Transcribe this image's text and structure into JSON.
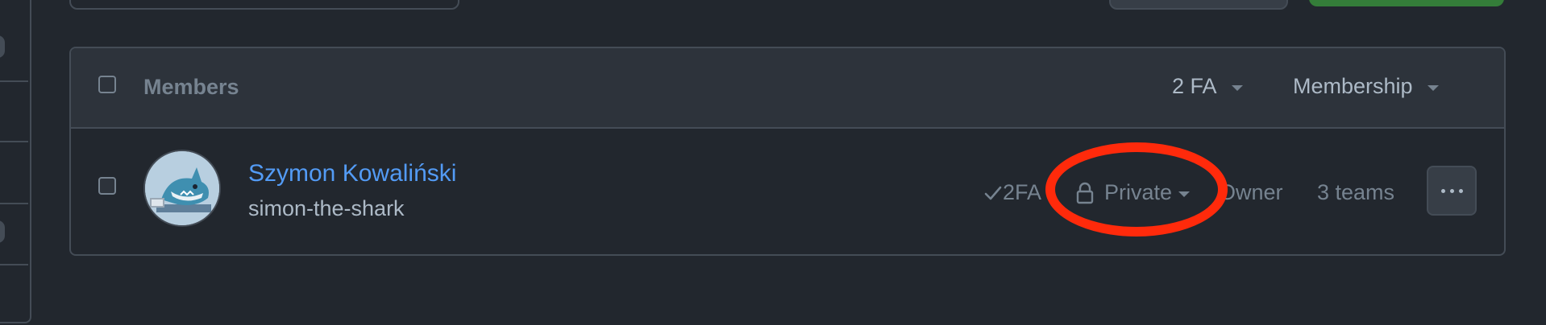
{
  "members_table": {
    "header": {
      "title": "Members",
      "filter_2fa": "2 FA",
      "filter_membership": "Membership"
    },
    "rows": [
      {
        "name": "Szymon Kowaliński",
        "login": "simon-the-shark",
        "two_factor": "2FA",
        "visibility": "Private",
        "role": "Owner",
        "teams": "3 teams"
      }
    ]
  },
  "colors": {
    "background": "#22272e",
    "header_bg": "#2d333b",
    "border": "#444c56",
    "link": "#539bf5",
    "muted": "#768390",
    "primary_button": "#347d39",
    "annotation": "#ff2a0b"
  },
  "icons": {
    "check": "check-icon",
    "lock": "lock-icon",
    "more": "kebab-horizontal-icon"
  }
}
